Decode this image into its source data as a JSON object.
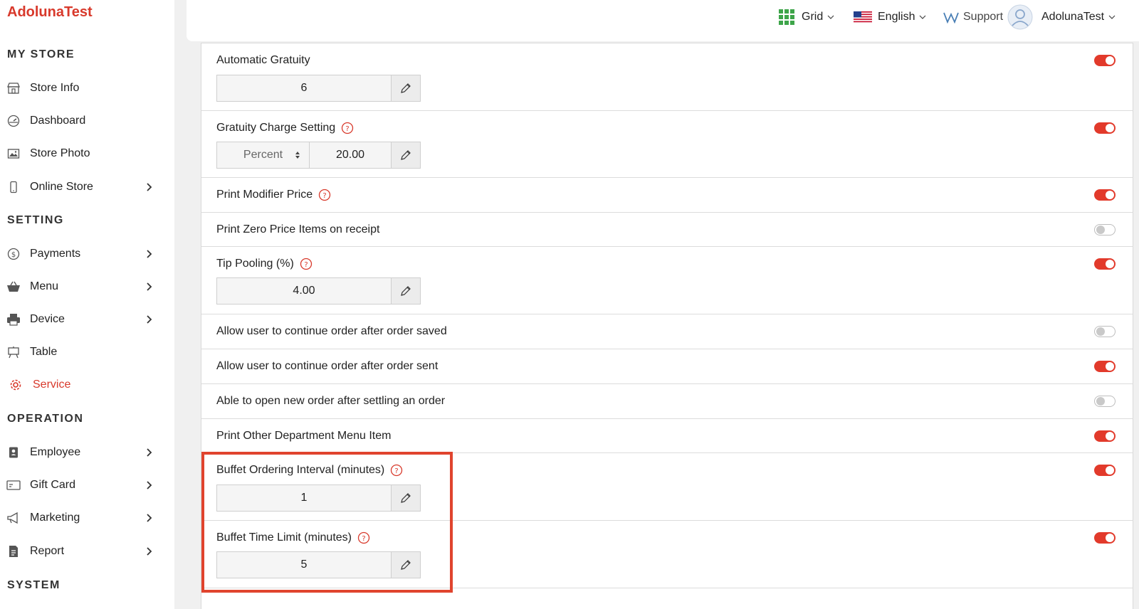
{
  "app": {
    "brand": "AdolunaTest"
  },
  "sidebar": {
    "sections": {
      "my_store": "MY STORE",
      "setting": "SETTING",
      "operation": "OPERATION",
      "system": "SYSTEM"
    },
    "items": [
      {
        "label": "Store Info",
        "icon": "store-icon",
        "has_chevron": false
      },
      {
        "label": "Dashboard",
        "icon": "gauge-icon",
        "has_chevron": false
      },
      {
        "label": "Store Photo",
        "icon": "image-icon",
        "has_chevron": false
      },
      {
        "label": "Online Store",
        "icon": "phone-icon",
        "has_chevron": true
      },
      {
        "label": "Payments",
        "icon": "dollar-coin-icon",
        "has_chevron": true
      },
      {
        "label": "Menu",
        "icon": "basket-icon",
        "has_chevron": true
      },
      {
        "label": "Device",
        "icon": "printer-icon",
        "has_chevron": true
      },
      {
        "label": "Table",
        "icon": "table-icon",
        "has_chevron": false
      },
      {
        "label": "Service",
        "icon": "gear-icon",
        "has_chevron": false,
        "active": true
      },
      {
        "label": "Employee",
        "icon": "badge-icon",
        "has_chevron": true
      },
      {
        "label": "Gift Card",
        "icon": "card-icon",
        "has_chevron": true
      },
      {
        "label": "Marketing",
        "icon": "megaphone-icon",
        "has_chevron": true
      },
      {
        "label": "Report",
        "icon": "report-icon",
        "has_chevron": true
      }
    ]
  },
  "header": {
    "grid_label": "Grid",
    "language_label": "English",
    "support_label": "Support",
    "user_label": "AdolunaTest"
  },
  "settings": [
    {
      "title": "Automatic Gratuity",
      "help": false,
      "enabled": true,
      "value": "6"
    },
    {
      "title": "Gratuity Charge Setting",
      "help": true,
      "enabled": true,
      "select": "Percent",
      "value": "20.00"
    },
    {
      "title": "Print Modifier Price",
      "help": true,
      "enabled": true
    },
    {
      "title": "Print Zero Price Items on receipt",
      "help": false,
      "enabled": false
    },
    {
      "title": "Tip Pooling (%)",
      "help": true,
      "enabled": true,
      "value": "4.00"
    },
    {
      "title": "Allow user to continue order after order saved",
      "help": false,
      "enabled": false
    },
    {
      "title": "Allow user to continue order after order sent",
      "help": false,
      "enabled": true
    },
    {
      "title": "Able to open new order after settling an order",
      "help": false,
      "enabled": false
    },
    {
      "title": "Print Other Department Menu Item",
      "help": false,
      "enabled": true
    },
    {
      "title": "Buffet Ordering Interval (minutes)",
      "help": true,
      "enabled": true,
      "value": "1"
    },
    {
      "title": "Buffet Time Limit (minutes)",
      "help": true,
      "enabled": true,
      "value": "5"
    }
  ],
  "colors": {
    "accent": "#d8392b",
    "toggle_on": "#e23a2b",
    "highlight": "#e0442e"
  }
}
